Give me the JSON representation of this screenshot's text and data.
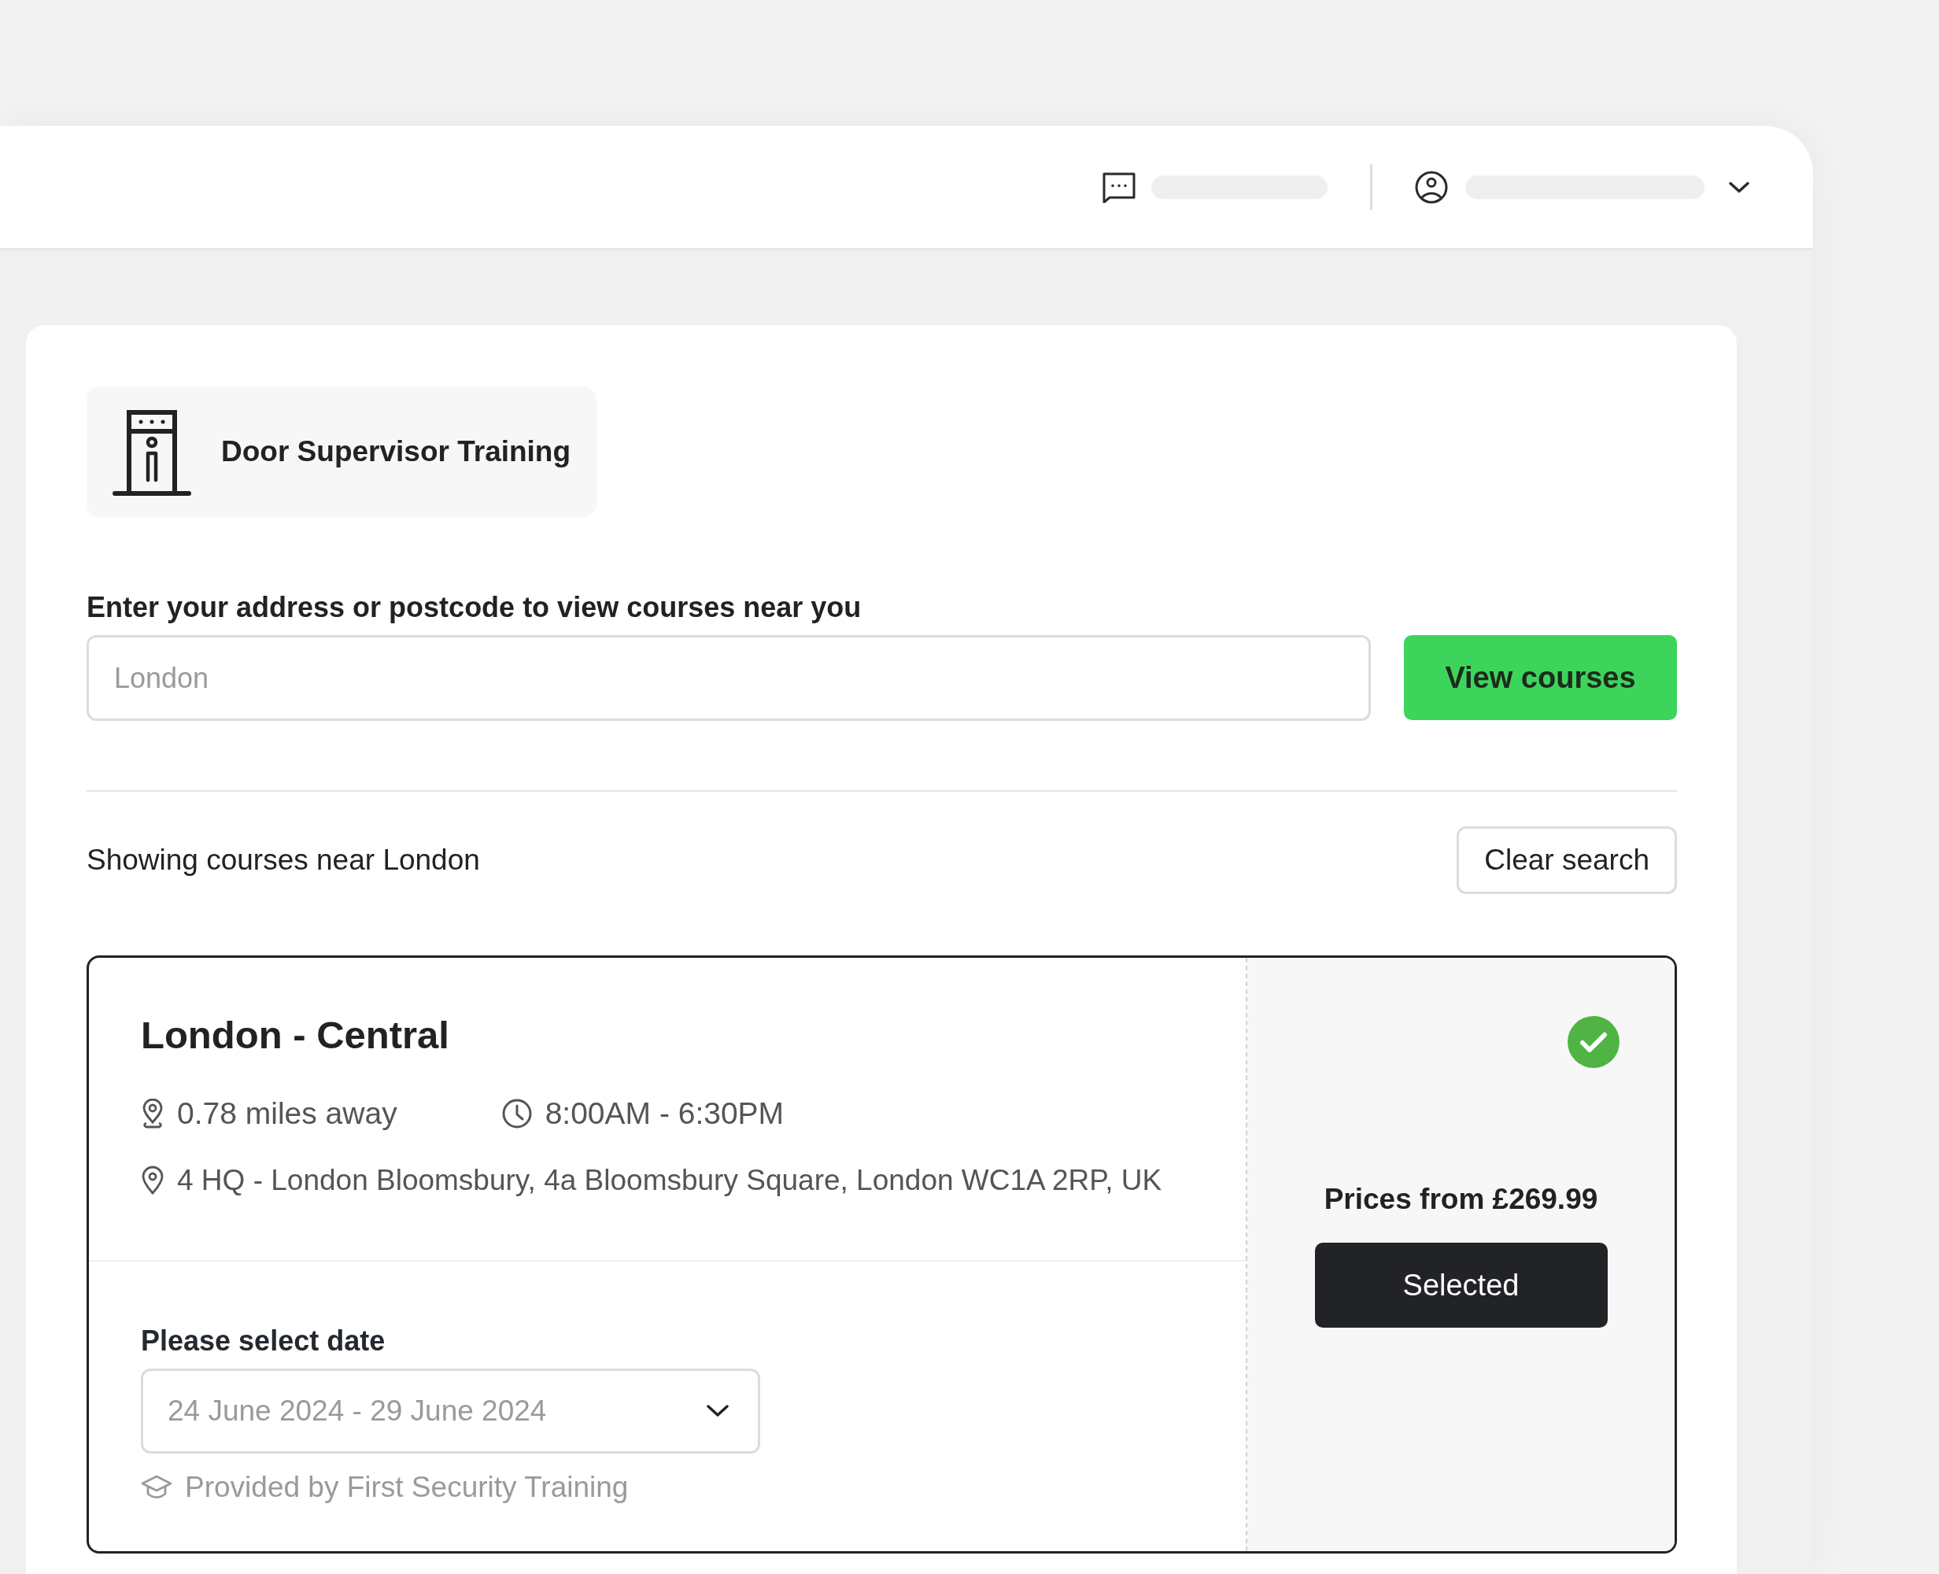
{
  "program": {
    "title": "Door Supervisor Training"
  },
  "search": {
    "label": "Enter your address or postcode to view courses near you",
    "placeholder": "London",
    "button": "View courses"
  },
  "results": {
    "summary": "Showing courses near London",
    "clear_button": "Clear search"
  },
  "courses": [
    {
      "name": "London - Central",
      "distance": "0.78 miles away",
      "hours": "8:00AM - 6:30PM",
      "address": "4 HQ - London Bloomsbury, 4a Bloomsbury Square, London WC1A 2RP, UK",
      "date_label": "Please select date",
      "date_value": "24 June 2024 - 29 June 2024",
      "provider": "Provided by First Security Training",
      "price": "Prices from £269.99",
      "button": "Selected",
      "selected": true
    }
  ]
}
